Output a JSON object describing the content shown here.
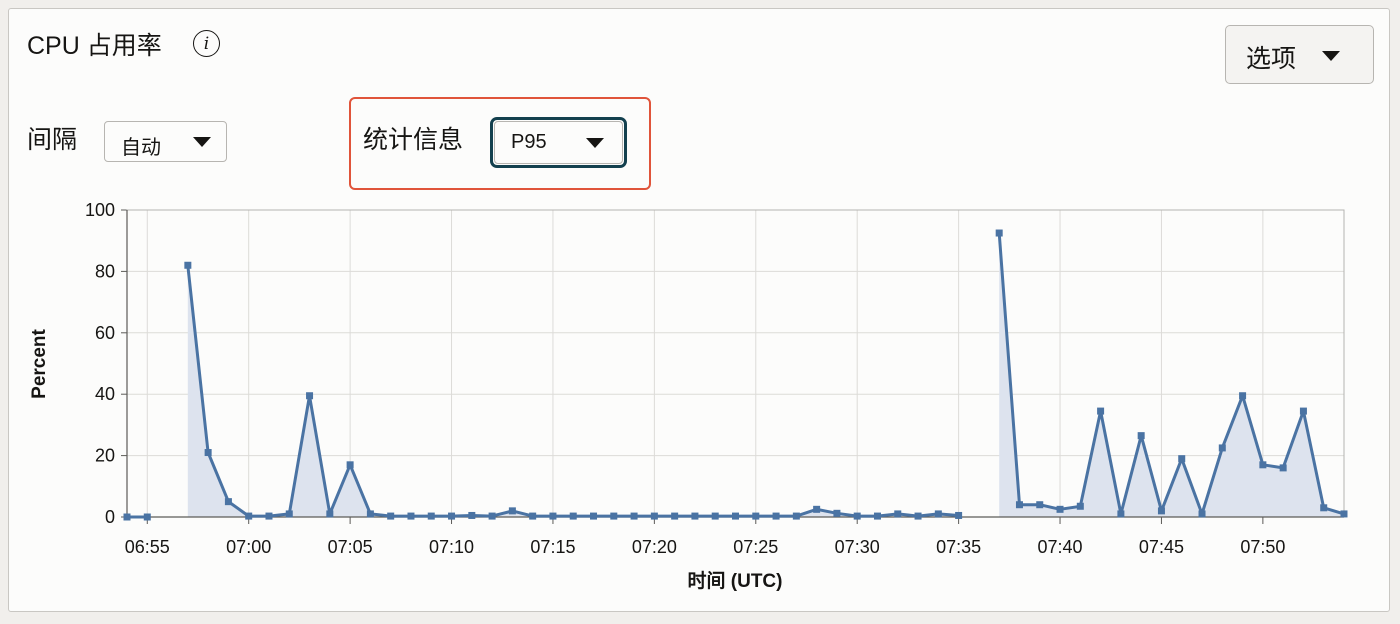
{
  "header": {
    "title": "CPU 占用率",
    "info_icon": "info-icon",
    "options_label": "选项"
  },
  "controls": {
    "interval_label": "间隔",
    "interval_value": "自动",
    "statistic_label": "统计信息",
    "statistic_value": "P95"
  },
  "colors": {
    "line": "#4a73a3",
    "area": "#dde3ee",
    "highlight": "#e0543a",
    "focus": "#13404e"
  },
  "chart_data": {
    "type": "area",
    "xlabel": "时间 (UTC)",
    "ylabel": "Percent",
    "ylim": [
      0,
      100
    ],
    "yticks": [
      0,
      20,
      40,
      60,
      80,
      100
    ],
    "xlim": [
      "06:54",
      "07:54"
    ],
    "xticks": [
      "06:55",
      "07:00",
      "07:05",
      "07:10",
      "07:15",
      "07:20",
      "07:25",
      "07:30",
      "07:35",
      "07:40",
      "07:45",
      "07:50"
    ],
    "grid": true,
    "series": [
      {
        "segments": [
          {
            "x": [
              "06:54",
              "06:55"
            ],
            "y": [
              0,
              0
            ]
          },
          {
            "x": [
              "06:57",
              "06:58",
              "06:59",
              "07:00",
              "07:01",
              "07:02",
              "07:03",
              "07:04",
              "07:05",
              "07:06",
              "07:07",
              "07:08",
              "07:09",
              "07:10",
              "07:11",
              "07:12",
              "07:13",
              "07:14",
              "07:15",
              "07:16",
              "07:17",
              "07:18",
              "07:19",
              "07:20",
              "07:21",
              "07:22",
              "07:23",
              "07:24",
              "07:25",
              "07:26",
              "07:27",
              "07:28",
              "07:29",
              "07:30",
              "07:31",
              "07:32",
              "07:33",
              "07:34",
              "07:35"
            ],
            "y": [
              82,
              21,
              5,
              0.3,
              0.3,
              1,
              39.5,
              1,
              17,
              1,
              0.3,
              0.3,
              0.3,
              0.3,
              0.5,
              0.3,
              2,
              0.3,
              0.3,
              0.3,
              0.3,
              0.3,
              0.3,
              0.3,
              0.3,
              0.3,
              0.3,
              0.3,
              0.3,
              0.3,
              0.3,
              2.5,
              1.2,
              0.3,
              0.3,
              1,
              0.3,
              1,
              0.5
            ]
          },
          {
            "x": [
              "07:37",
              "07:38",
              "07:39",
              "07:40",
              "07:41",
              "07:42",
              "07:43",
              "07:44",
              "07:45",
              "07:46",
              "07:47",
              "07:48",
              "07:49",
              "07:50",
              "07:51",
              "07:52",
              "07:53",
              "07:54"
            ],
            "y": [
              92.5,
              4,
              4,
              2.5,
              3.5,
              34.5,
              1,
              26.5,
              2,
              19,
              1,
              22.5,
              39.5,
              17,
              16,
              34.5,
              3,
              1
            ]
          }
        ]
      }
    ]
  }
}
